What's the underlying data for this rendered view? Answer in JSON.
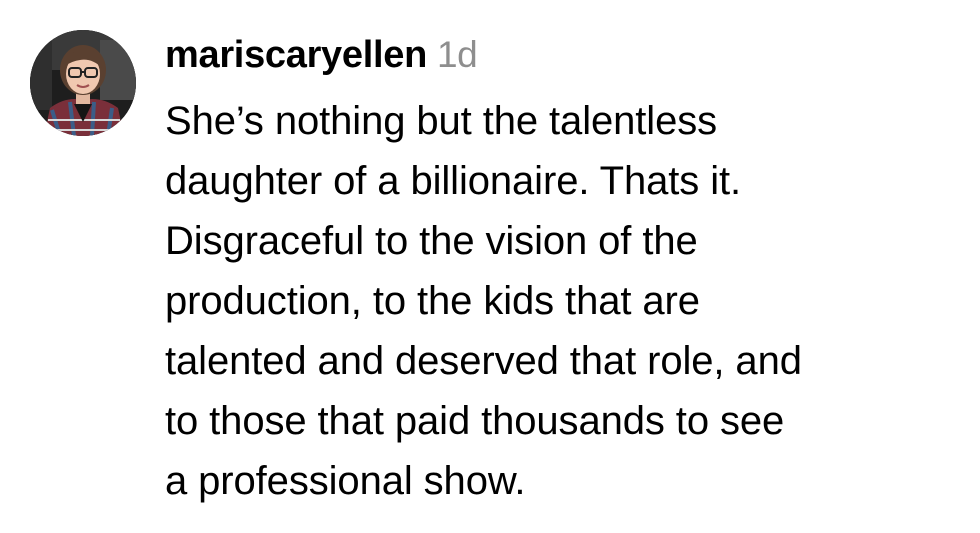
{
  "comment": {
    "avatar_icon": "user-avatar-photo",
    "username": "mariscaryellen",
    "timestamp": "1d",
    "text": "She’s nothing but the talentless\ndaughter of a billionaire. Thats it.\nDisgraceful to the vision of the\nproduction, to the kids that are\ntalented and deserved that role, and\nto those that paid thousands to see\na professional show.",
    "colors": {
      "username": "#000000",
      "timestamp": "#8e8e8e",
      "text": "#000000",
      "background": "#ffffff"
    }
  }
}
